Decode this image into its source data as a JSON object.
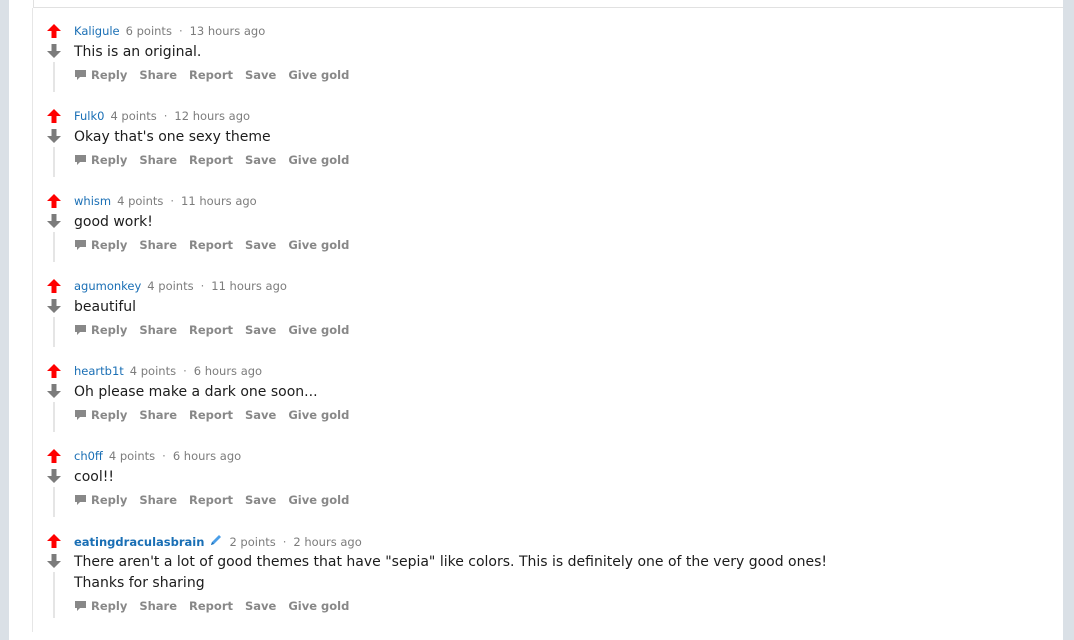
{
  "colors": {
    "background": "#dae0e6",
    "upvote": "#ff0000",
    "downvote": "#7c7c7c",
    "author": "#1a6fb5",
    "text": "#1c1c1c",
    "meta": "#7c7c7c"
  },
  "actions": {
    "reply": "Reply",
    "share": "Share",
    "report": "Report",
    "save": "Save",
    "give_gold": "Give gold"
  },
  "separator": "·",
  "comments": [
    {
      "author": "Kaligule",
      "points": "6 points",
      "time": "13 hours ago",
      "text": "This is an original."
    },
    {
      "author": "Fulk0",
      "points": "4 points",
      "time": "12 hours ago",
      "text": "Okay that's one sexy theme"
    },
    {
      "author": "whism",
      "points": "4 points",
      "time": "11 hours ago",
      "text": "good work!"
    },
    {
      "author": "agumonkey",
      "points": "4 points",
      "time": "11 hours ago",
      "text": "beautiful"
    },
    {
      "author": "heartb1t",
      "points": "4 points",
      "time": "6 hours ago",
      "text": "Oh please make a dark one soon..."
    },
    {
      "author": "ch0ff",
      "points": "4 points",
      "time": "6 hours ago",
      "text": "cool!!"
    },
    {
      "author": "eatingdraculasbrain",
      "points": "2 points",
      "time": "2 hours ago",
      "text": "There aren't a lot of good themes that have \"sepia\" like colors. This is definitely one of the very good ones! Thanks for sharing",
      "author_icon": "pencil-icon"
    }
  ]
}
